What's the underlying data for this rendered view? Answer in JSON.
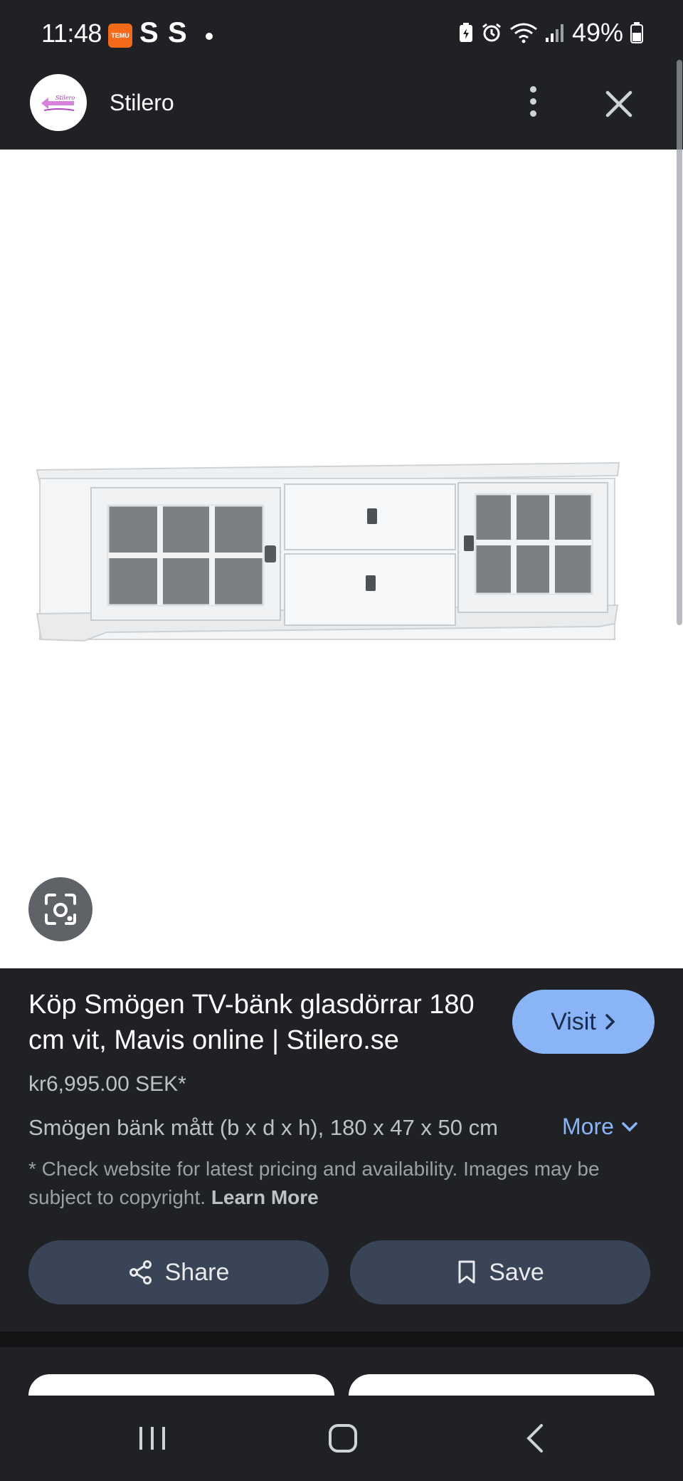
{
  "status_bar": {
    "time": "11:48",
    "app_icon_text": "TEMU",
    "notification_s1": "S",
    "notification_s2": "S",
    "battery_text": "49%"
  },
  "header": {
    "site_name": "Stilero",
    "logo_text": "Stilero"
  },
  "product": {
    "title": "Köp Smögen TV-bänk glasdörrar 180 cm vit, Mavis online | Stilero.se",
    "price": "kr6,995.00 SEK*",
    "description": "Smögen bänk mått (b x d x h), 180 x 47 x 50 cm",
    "more_label": "More",
    "visit_label": "Visit"
  },
  "disclaimer": {
    "text": "* Check website for latest pricing and availability. Images may be subject to copyright. ",
    "learn_more": "Learn More"
  },
  "actions": {
    "share_label": "Share",
    "save_label": "Save"
  },
  "colors": {
    "background": "#1f2125",
    "accent": "#8ab4f8",
    "action_button": "#394457"
  }
}
